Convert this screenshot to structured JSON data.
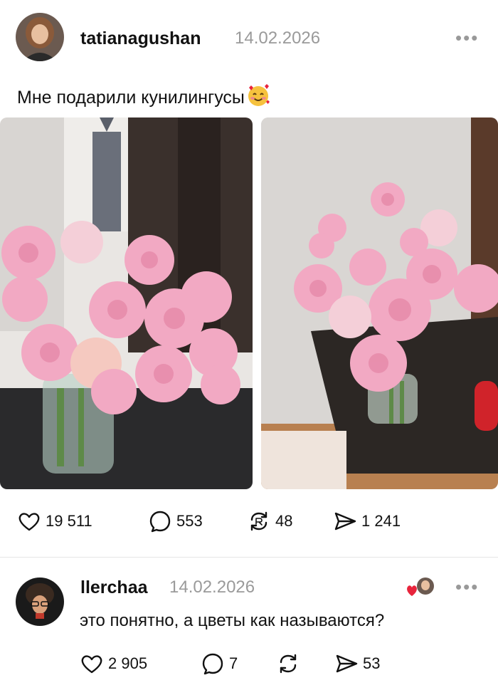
{
  "post": {
    "username": "tatianagushan",
    "date": "14.02.2026",
    "more_label": "•••",
    "text": "Мне подарили кунилингусы",
    "emoji_icon": "smiling-face-with-hearts",
    "actions": {
      "likes": "19 511",
      "comments": "553",
      "reposts": "48",
      "shares": "1 241"
    }
  },
  "comment": {
    "username": "llerchaa",
    "date": "14.02.2026",
    "more_label": "•••",
    "text": "это понятно, а цветы как называются?",
    "actions": {
      "likes": "2 905",
      "comments": "7",
      "shares": "53"
    }
  },
  "colors": {
    "muted": "#9a9a9a",
    "like_red": "#e8243c"
  }
}
